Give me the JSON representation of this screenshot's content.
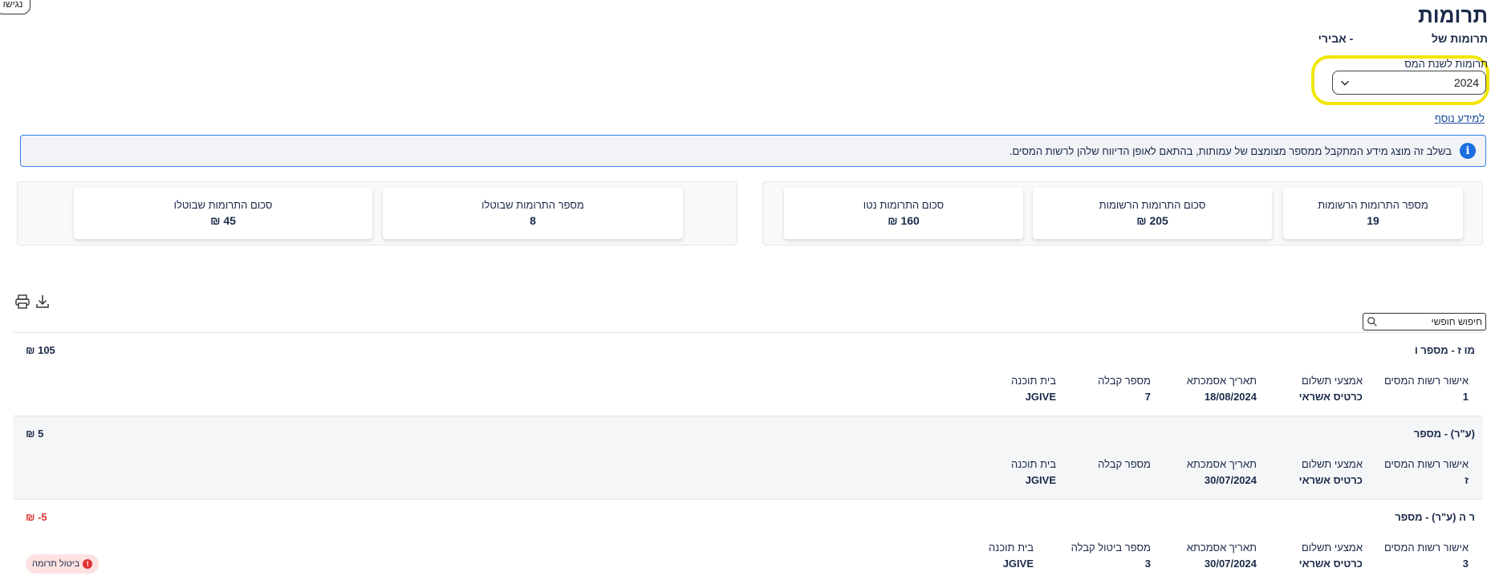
{
  "accessibility_label": "נגישו",
  "page_title": "תרומות",
  "subtitle_prefix": "תרומות של",
  "subtitle_suffix": "- אבירי ",
  "tax_year_label": "תרומות לשנת המס",
  "tax_year_value": "2024",
  "more_info_link": "למידע נוסף",
  "info_text": "בשלב זה מוצג מידע המתקבל ממספר מצומצם של עמותות, בהתאם לאופן הדיווח שלהן לרשות המסים.",
  "stats_right": [
    {
      "label": "מספר התרומות הרשומות",
      "value": "19"
    },
    {
      "label": "סכום התרומות הרשומות",
      "value": "205 ₪"
    },
    {
      "label": "סכום התרומות נטו",
      "value": "160 ₪"
    }
  ],
  "stats_left": [
    {
      "label": "מספר התרומות שבוטלו",
      "value": "8"
    },
    {
      "label": "סכום התרומות שבוטלו",
      "value": "45 ₪"
    }
  ],
  "search_placeholder": "חיפוש חופשי",
  "donations": [
    {
      "title": "מו                  ז - מספר ו",
      "amount": "₪ 105",
      "fields": [
        {
          "label": "אישור רשות המסים",
          "value": "1"
        },
        {
          "label": "אמצעי תשלום",
          "value": "כרטיס אשראי"
        },
        {
          "label": "תאריך אסמכתא",
          "value": "18/08/2024"
        },
        {
          "label": "מספר קבלה",
          "value": "7"
        },
        {
          "label": "בית תוכנה",
          "value": "JGIVE"
        }
      ]
    },
    {
      "title": "(ע\"ר) - מספר",
      "amount": "₪ 5",
      "fields": [
        {
          "label": "אישור רשות המסים",
          "value": "ז"
        },
        {
          "label": "אמצעי תשלום",
          "value": "כרטיס אשראי"
        },
        {
          "label": "תאריך אסמכתא",
          "value": "30/07/2024"
        },
        {
          "label": "מספר קבלה",
          "value": ""
        },
        {
          "label": "בית תוכנה",
          "value": "JGIVE"
        }
      ]
    },
    {
      "title": "ר            ה (ע\"ר) - מספר",
      "amount": "₪ -5",
      "fields": [
        {
          "label": "אישור רשות המסים",
          "value": "3"
        },
        {
          "label": "אמצעי תשלום",
          "value": "כרטיס אשראי"
        },
        {
          "label": "תאריך אסמכתא",
          "value": "30/07/2024"
        },
        {
          "label": "מספר ביטול קבלה",
          "value": "3"
        },
        {
          "label": "בית תוכנה",
          "value": "JGIVE"
        }
      ],
      "badge": "ביטול תרומה"
    }
  ],
  "colors": {
    "accent": "#1e6fe0",
    "highlight": "#f2e600",
    "negative": "#e03030",
    "text": "#1b2a4a"
  }
}
